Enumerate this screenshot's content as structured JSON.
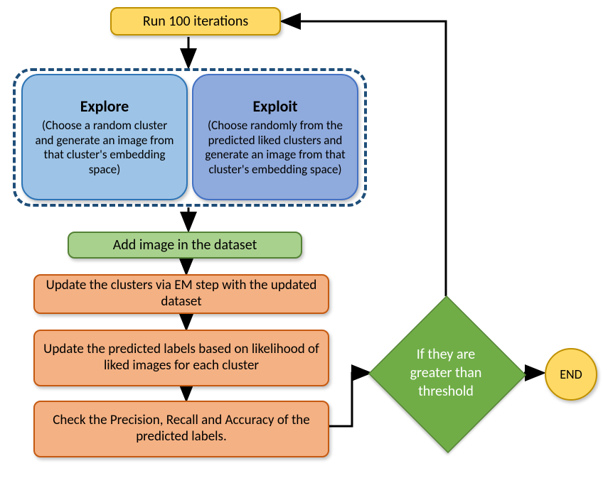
{
  "run": {
    "label": "Run 100 iterations"
  },
  "explore": {
    "title": "Explore",
    "body": "(Choose a random cluster and generate an image from that cluster's embedding space)"
  },
  "exploit": {
    "title": "Exploit",
    "body": "(Choose randomly from the predicted liked clusters and generate an image from that cluster's embedding space)"
  },
  "add": {
    "label": "Add image in the dataset"
  },
  "update1": {
    "label": "Update the clusters via EM step with the updated dataset"
  },
  "update2": {
    "label": "Update the predicted labels based on likelihood of liked images for each cluster"
  },
  "check": {
    "label": "Check the Precision, Recall and Accuracy of the predicted labels."
  },
  "decision": {
    "label": "If they are greater than threshold"
  },
  "end": {
    "label": "END"
  }
}
